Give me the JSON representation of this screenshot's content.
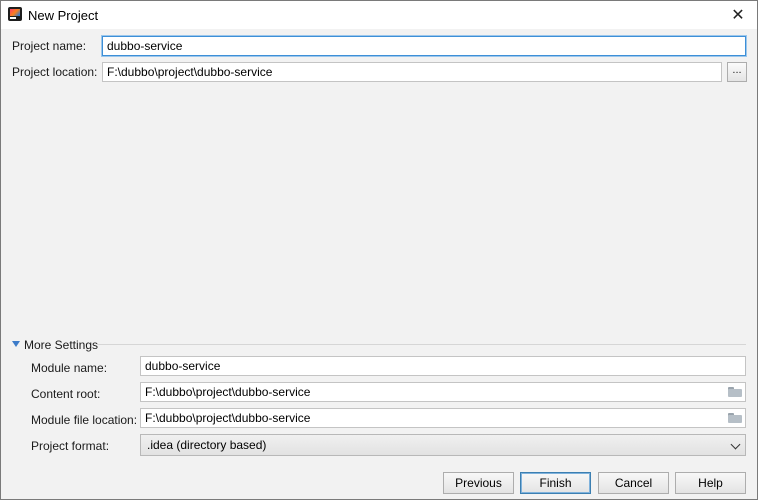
{
  "window": {
    "title": "New Project",
    "close_glyph": "✕"
  },
  "form": {
    "project_name_label": "Project name:",
    "project_name_value": "dubbo-service",
    "project_location_label": "Project location:",
    "project_location_value": "F:\\dubbo\\project\\dubbo-service",
    "browse_label": "..."
  },
  "more_settings": {
    "title": "More Settings",
    "expanded": true,
    "module_name_label": "Module name:",
    "module_name_value": "dubbo-service",
    "content_root_label": "Content root:",
    "content_root_value": "F:\\dubbo\\project\\dubbo-service",
    "module_file_location_label": "Module file location:",
    "module_file_location_value": "F:\\dubbo\\project\\dubbo-service",
    "project_format_label": "Project format:",
    "project_format_value": ".idea (directory based)"
  },
  "buttons": {
    "previous": "Previous",
    "finish": "Finish",
    "cancel": "Cancel",
    "help": "Help"
  },
  "icons": {
    "app": "intellij-idea-icon",
    "close": "close-icon",
    "folder": "folder-icon",
    "expand": "triangle-down-icon",
    "dropdown": "chevron-down-icon"
  },
  "colors": {
    "focus_border": "#3d8fd7",
    "default_button_border": "#3c7fb1",
    "expand_triangle": "#3d7cc9",
    "dialog_background": "#f2f2f2"
  }
}
